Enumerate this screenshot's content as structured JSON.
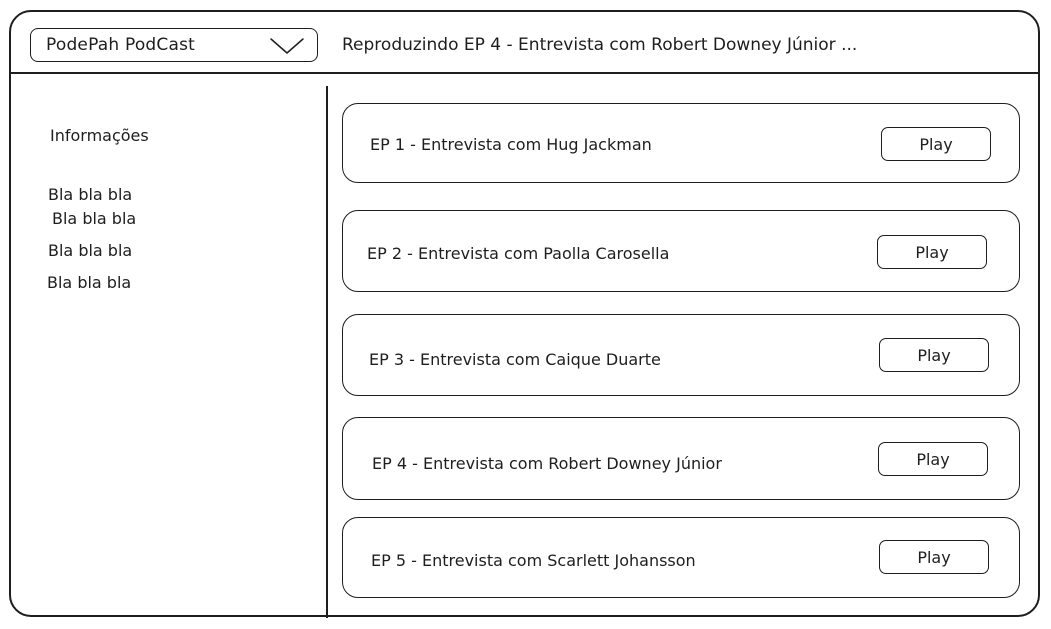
{
  "header": {
    "podcast_select": {
      "value": "PodePah PodCast",
      "icon": "chevron-down-icon"
    },
    "now_playing": "Reproduzindo EP 4 - Entrevista com Robert Downey Júnior ..."
  },
  "sidebar": {
    "title": "Informações",
    "lines": [
      "Bla bla bla",
      "Bla bla bla",
      "Bla bla bla",
      "Bla bla bla"
    ]
  },
  "episodes": [
    {
      "title": "EP 1 - Entrevista com Hug Jackman",
      "play_label": "Play"
    },
    {
      "title": "EP 2 - Entrevista com Paolla Carosella",
      "play_label": "Play"
    },
    {
      "title": "EP 3 - Entrevista com Caique Duarte",
      "play_label": "Play"
    },
    {
      "title": "EP 4 - Entrevista com Robert Downey Júnior",
      "play_label": "Play"
    },
    {
      "title": "EP 5 - Entrevista com Scarlett Johansson",
      "play_label": "Play"
    }
  ],
  "colors": {
    "stroke": "#1e1e1e",
    "background": "#ffffff"
  }
}
